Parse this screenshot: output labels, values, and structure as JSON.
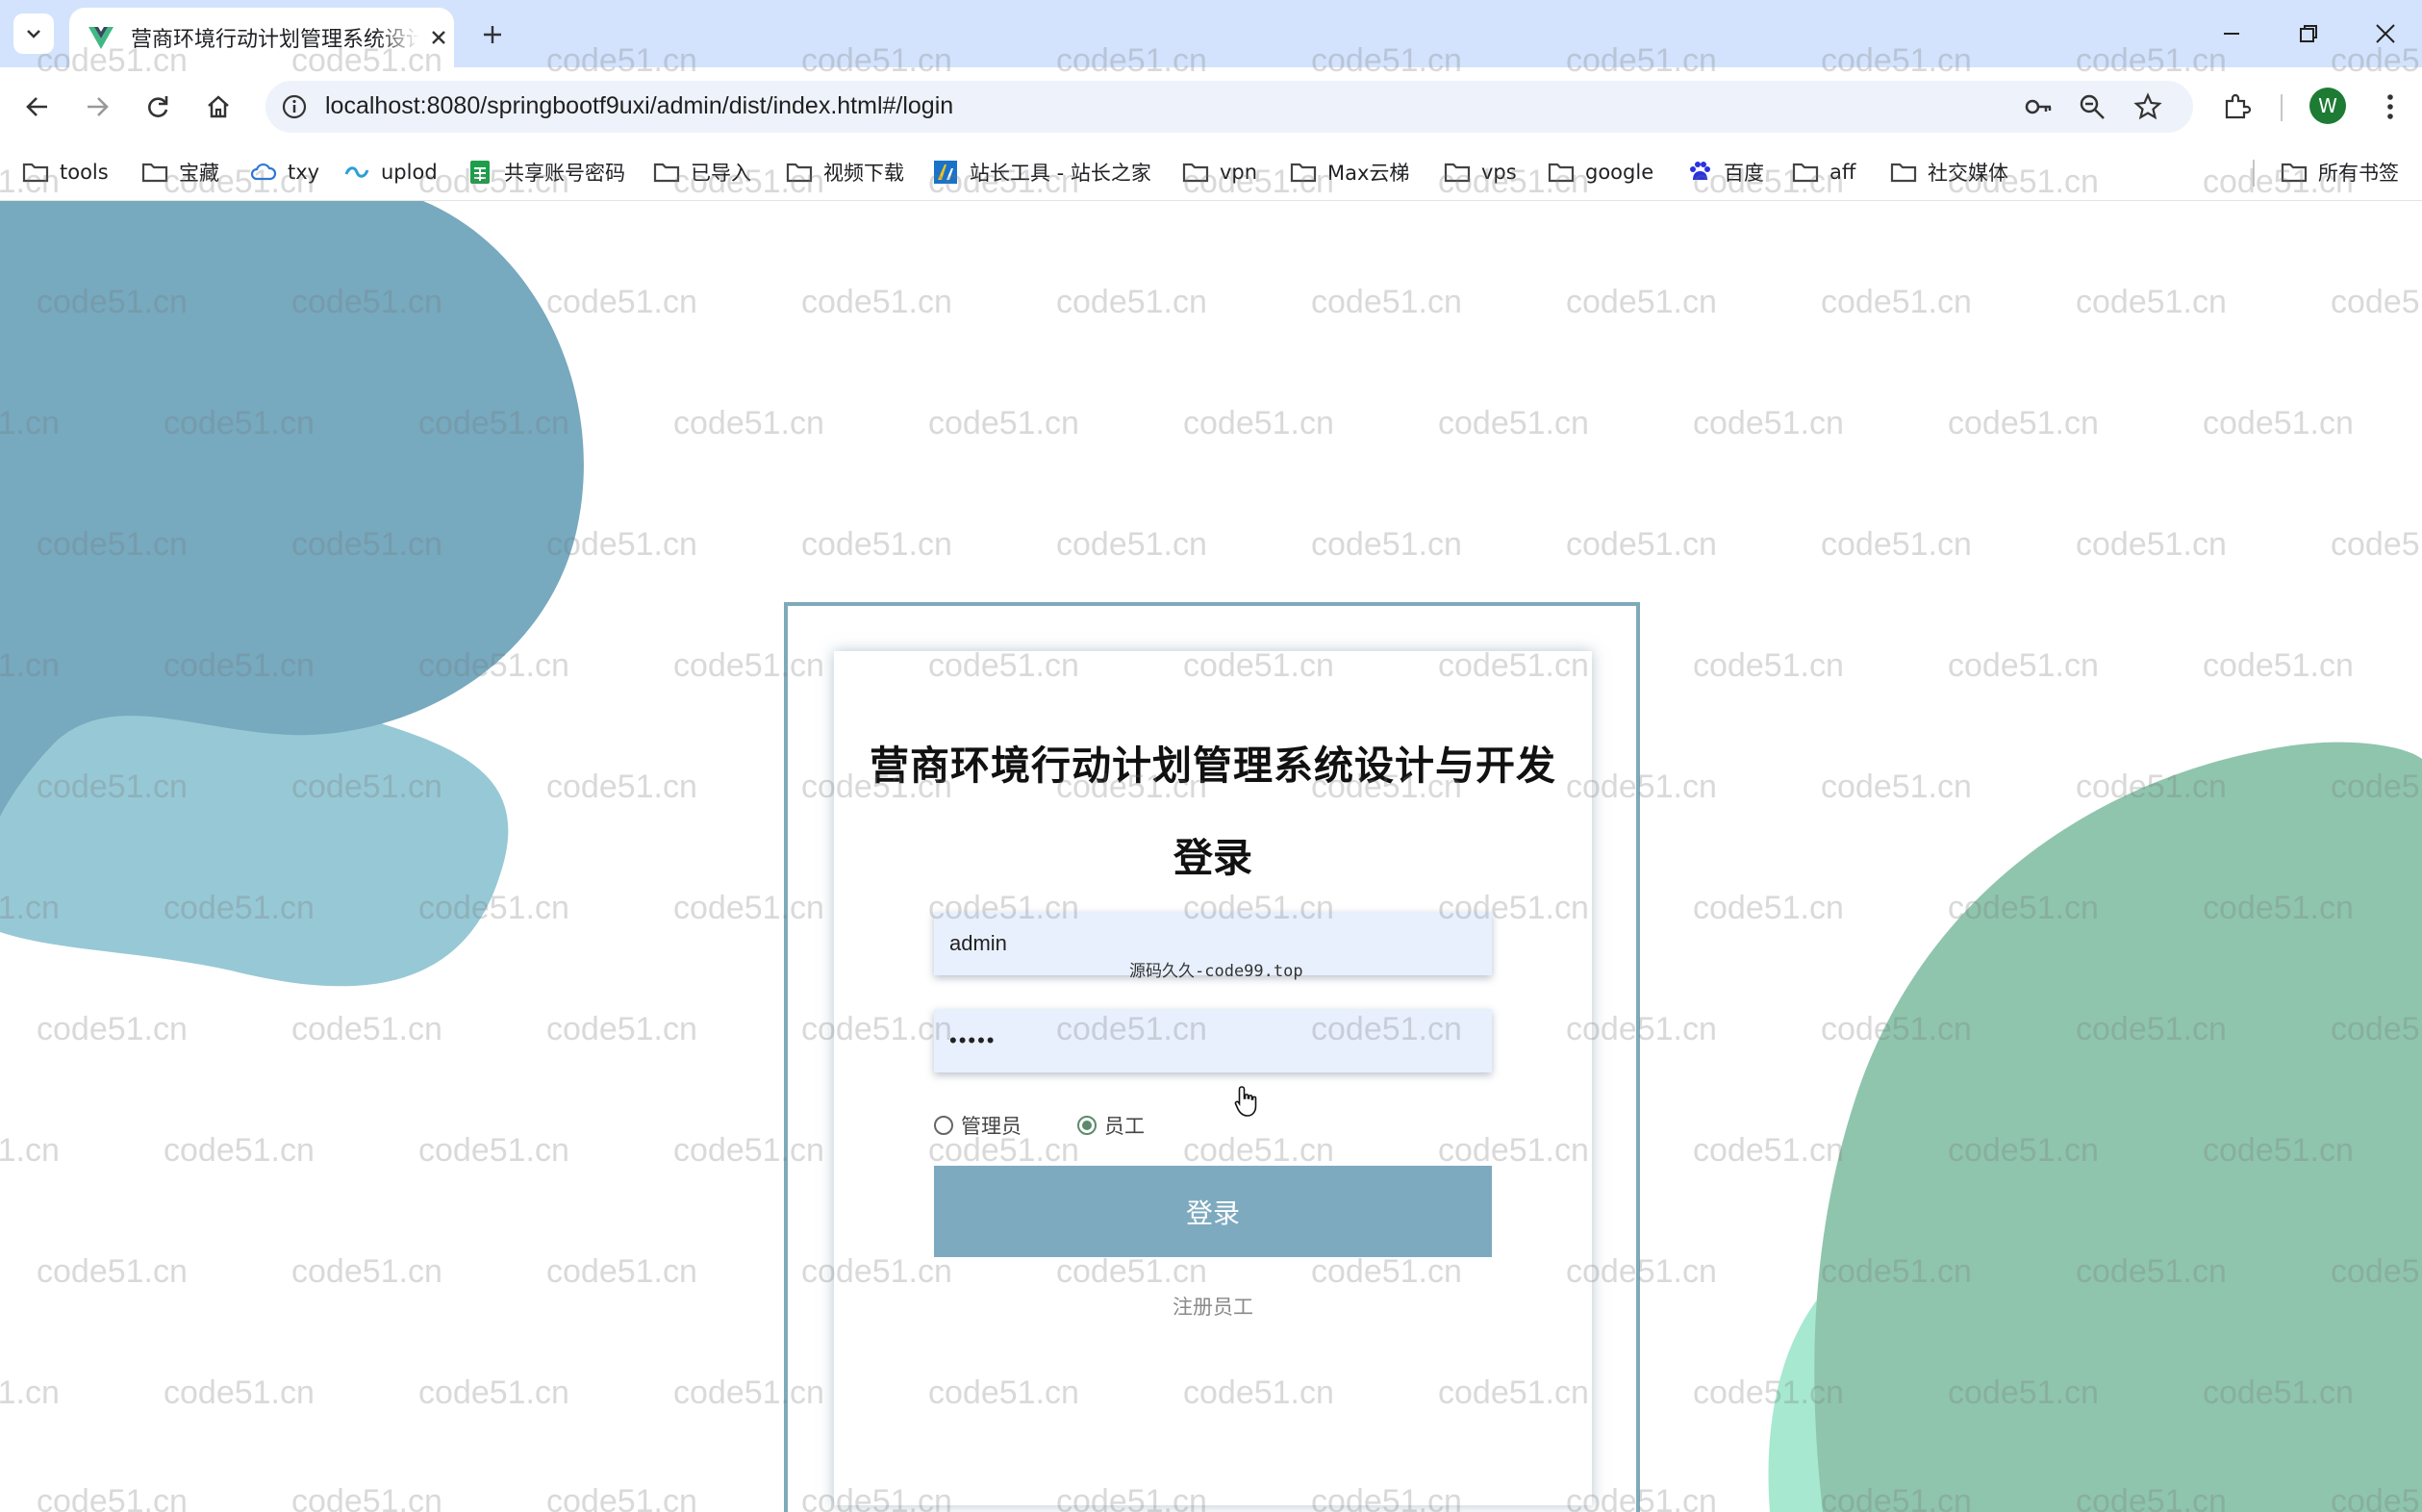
{
  "browser": {
    "tab_title": "营商环境行动计划管理系统设计与开发",
    "url": "localhost:8080/springbootf9uxi/admin/dist/index.html#/login",
    "avatar_letter": "W",
    "bookmarks": [
      {
        "label": "tools",
        "icon": "folder-icon"
      },
      {
        "label": "宝藏",
        "icon": "folder-icon"
      },
      {
        "label": "txy",
        "icon": "cloud-icon"
      },
      {
        "label": "uplod",
        "icon": "link-icon"
      },
      {
        "label": "共享账号密码",
        "icon": "sheet-icon"
      },
      {
        "label": "已导入",
        "icon": "folder-icon"
      },
      {
        "label": "视频下载",
        "icon": "folder-icon"
      },
      {
        "label": "站长工具 - 站长之家",
        "icon": "site-icon"
      },
      {
        "label": "vpn",
        "icon": "folder-icon"
      },
      {
        "label": "Max云梯",
        "icon": "folder-icon"
      },
      {
        "label": "vps",
        "icon": "folder-icon"
      },
      {
        "label": "google",
        "icon": "folder-icon"
      },
      {
        "label": "百度",
        "icon": "baidu-icon"
      },
      {
        "label": "aff",
        "icon": "folder-icon"
      },
      {
        "label": "社交媒体",
        "icon": "folder-icon"
      }
    ],
    "all_bookmarks": "所有书签"
  },
  "login": {
    "system_title": "营商环境行动计划管理系统设计与开发",
    "title": "登录",
    "username_value": "admin",
    "password_value": "•••••",
    "inner_watermark": "源码久久-code99.top",
    "roles": [
      {
        "label": "管理员",
        "checked": false
      },
      {
        "label": "员工",
        "checked": true
      }
    ],
    "login_button": "登录",
    "register_link": "注册员工"
  },
  "watermark": "code51.cn",
  "colors": {
    "frame": "#7eaab9",
    "button": "#7eaac0",
    "blob_blue_dark": "#77a9bf",
    "blob_blue_light": "#97c8d5",
    "blob_green_dark": "#8fc5ad",
    "blob_green_light": "#a6e8d0"
  }
}
